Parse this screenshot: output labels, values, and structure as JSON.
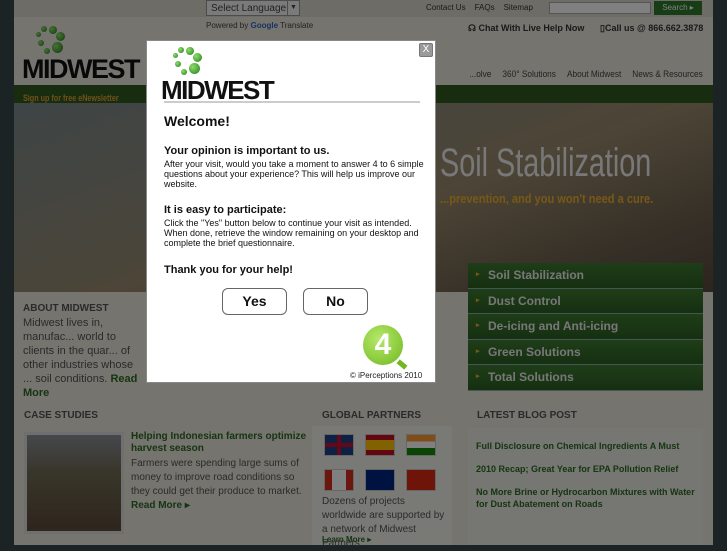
{
  "topbar": {
    "language_select": "Select Language",
    "links": [
      "Contact Us",
      "FAQs",
      "Sitemap"
    ],
    "search_placeholder": "",
    "search_button": "Search ▸",
    "powered_by": "Powered by",
    "google": "Google",
    "translate": "Translate"
  },
  "header": {
    "logo_text": "MIDWEST",
    "chat": "Chat With Live Help Now",
    "call": "Call us @ 866.662.3878",
    "nav": [
      "...olve",
      "360° Solutions",
      "About Midwest",
      "News & Resources"
    ]
  },
  "newsletter": "Sign up for free eNewsletter",
  "hero": {
    "headline": "Soil Stabilization",
    "tagline": "...prevention, and you won't need a cure."
  },
  "sidenav": [
    "Soil Stabilization",
    "Dust Control",
    "De-icing and Anti-icing",
    "Green Solutions",
    "Total Solutions"
  ],
  "about": {
    "heading": "ABOUT MIDWEST",
    "text": "Midwest lives in, manufac... world to clients in the quar... of other industries whose ... soil conditions.",
    "read_more": "Read More"
  },
  "case_studies": {
    "heading": "CASE STUDIES",
    "title": "Helping Indonesian farmers optimize harvest season",
    "text": "Farmers were spending large sums of money to improve road conditions so they could get their produce to market.",
    "read_more": "Read More ▸"
  },
  "global_partners": {
    "heading": "GLOBAL PARTNERS",
    "flags": [
      "united-kingdom",
      "spain",
      "india",
      "canada",
      "australia",
      "china"
    ],
    "text": "Dozens of projects worldwide are supported by a network of Midwest Partners...",
    "learn_more": "Learn More ▸"
  },
  "blog": {
    "heading": "LATEST BLOG POST",
    "posts": [
      "Full Disclosure on Chemical Ingredients A Must",
      "2010 Recap; Great Year for EPA Pollution Relief",
      "No More Brine or Hydrocarbon Mixtures with Water for Dust Abatement on Roads"
    ]
  },
  "modal": {
    "logo_text": "MIDWEST",
    "close": "X",
    "title": "Welcome!",
    "h1": "Your opinion is important to us.",
    "p1": "After your visit, would you take a moment to answer 4 to 6 simple questions about your experience? This will help us improve our website.",
    "h2": "It is easy to participate:",
    "p2": "Click the \"Yes\" button below to continue your visit as intended. When done, retrieve the window remaining on your desktop and complete the brief questionnaire.",
    "h3": "Thank you for your help!",
    "yes": "Yes",
    "no": "No",
    "badge": "4",
    "copyright": "© iPerceptions 2010"
  },
  "colors": {
    "brand_green": "#2d6a25",
    "accent_orange": "#f0b030"
  }
}
